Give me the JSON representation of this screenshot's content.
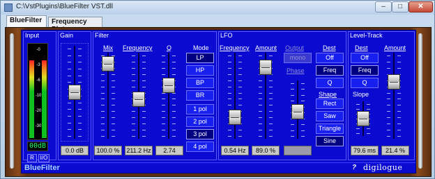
{
  "window": {
    "title": "C:\\VstPlugins\\BlueFilter VST.dll",
    "min": "–",
    "max": "□",
    "close": "✕"
  },
  "tabs": [
    {
      "label": "BlueFilter",
      "selected": true
    },
    {
      "label": "Frequency Plot",
      "selected": false
    }
  ],
  "input": {
    "title": "Input",
    "scale": [
      "-0",
      "-3",
      "-6",
      "-10",
      "-20",
      "-30"
    ],
    "readout": "00dB",
    "btn_r": "R",
    "btn_io": "I/O",
    "level": 0.82
  },
  "gain": {
    "title": "Gain",
    "value": "0.0 dB",
    "level": 0.5
  },
  "filter": {
    "title": "Filter",
    "mix_label": "Mix",
    "freq_label": "Frequency",
    "q_label": "Q",
    "mode_label": "Mode",
    "mix_value": "100.0 %",
    "freq_value": "211.2 Hz",
    "q_value": "2.74",
    "mix_level": 0.95,
    "freq_level": 0.45,
    "q_level": 0.65,
    "modes": [
      "LP",
      "HP",
      "BP",
      "BR"
    ],
    "mode_selected": "LP",
    "poles": [
      "1 pol",
      "2 pol",
      "3 pol",
      "4 pol"
    ],
    "pole_selected": "3 pol"
  },
  "lfo": {
    "title": "LFO",
    "freq_label": "Frequency",
    "amount_label": "Amount",
    "output_label": "Output",
    "output_value": "mono",
    "phase_label": "Phase",
    "dest_label": "Dest",
    "dests": [
      "Off",
      "Freq",
      "Q"
    ],
    "dest_selected": "Freq",
    "shape_label": "Shape",
    "shapes": [
      "Rect",
      "Saw",
      "Triangle",
      "Sine"
    ],
    "shape_selected": "Sine",
    "freq_value": "0.54 Hz",
    "amount_value": "89.0 %",
    "phase_value": "",
    "freq_level": 0.2,
    "amount_level": 0.9,
    "phase_level": 0.45
  },
  "level_track": {
    "title": "Level-Track",
    "dest_label": "Dest",
    "dests": [
      "Off",
      "Freq",
      "Q"
    ],
    "dest_selected": "Freq",
    "amount_label": "Amount",
    "slope_label": "Slope",
    "slope_value": "79.6 ms",
    "amount_value": "21.4 %",
    "slope_level": 0.5,
    "amount_level": 0.7
  },
  "status": {
    "title": "BlueFilter",
    "help": "?",
    "brand": "digilogue"
  }
}
